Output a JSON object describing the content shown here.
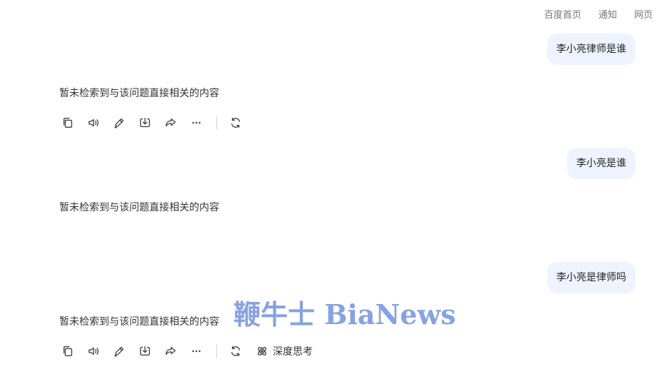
{
  "top_nav": {
    "items": [
      "百度首页",
      "通知",
      "网页"
    ]
  },
  "conversation": [
    {
      "question": "李小亮律师是谁",
      "answer": "暂未检索到与该问题直接相关的内容"
    },
    {
      "question": "李小亮是谁",
      "answer": "暂未检索到与该问题直接相关的内容"
    },
    {
      "question": "李小亮是律师吗",
      "answer": "暂未检索到与该问题直接相关的内容"
    }
  ],
  "toolbar": {
    "icons": [
      "copy-icon",
      "speaker-icon",
      "edit-icon",
      "download-icon",
      "share-icon",
      "more-icon",
      "regenerate-icon"
    ],
    "deep_think_label": "深度思考",
    "deep_think_icon": "atom-icon"
  },
  "watermark": {
    "text": "鞭牛士 BiaNews",
    "color": "#5a7fd6"
  },
  "colors": {
    "bubble_bg": "#eef3ff",
    "text": "#333333",
    "nav_text": "#777777"
  }
}
